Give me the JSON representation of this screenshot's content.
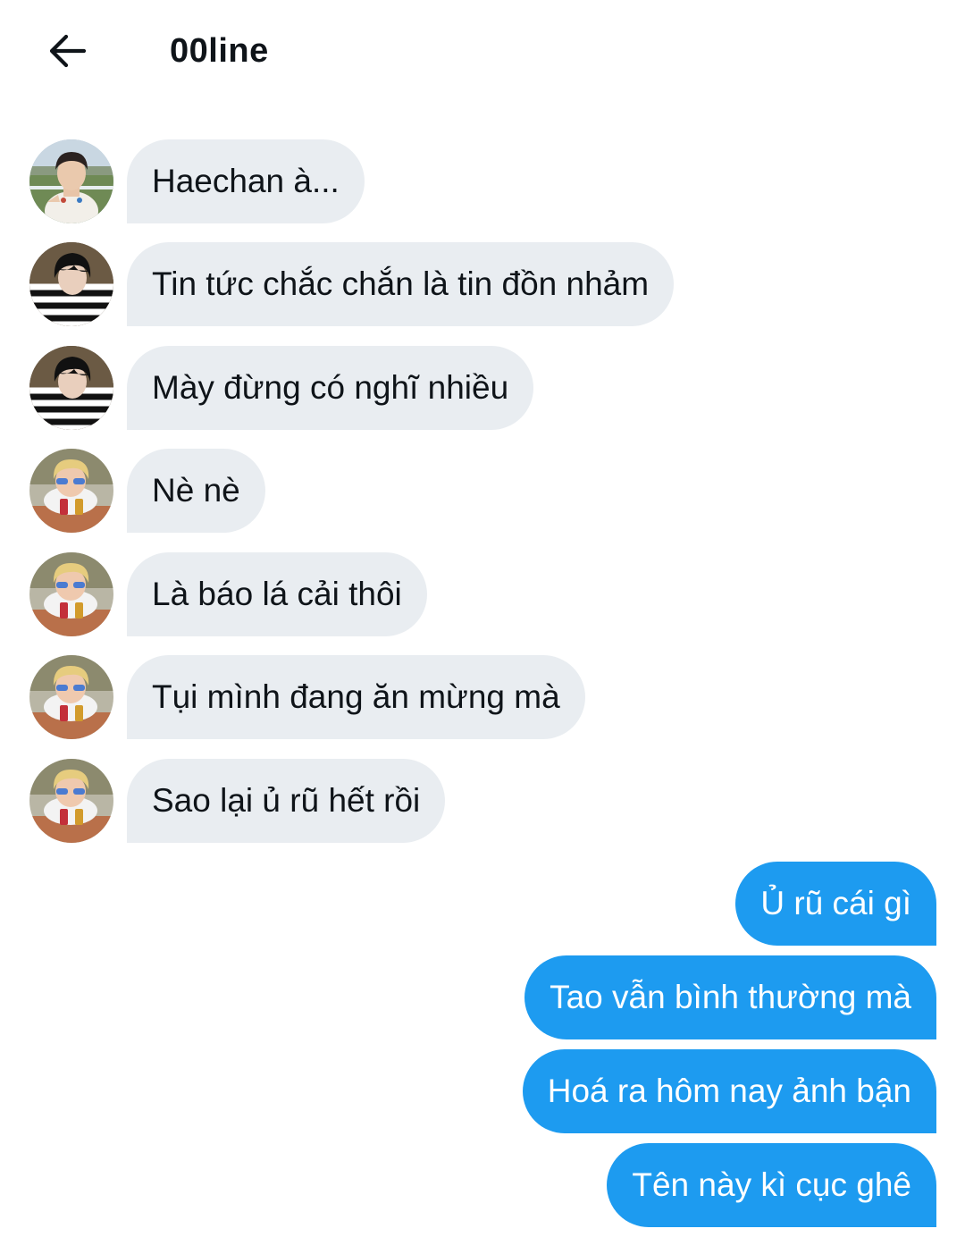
{
  "header": {
    "back_icon": "arrow-left-icon",
    "title": "00line"
  },
  "colors": {
    "incoming_bubble": "#e9edf1",
    "outgoing_bubble": "#1d9bf0",
    "text": "#0f1419"
  },
  "messages": [
    {
      "direction": "incoming",
      "avatar": "avatar-a",
      "text": "Haechan à..."
    },
    {
      "direction": "incoming",
      "avatar": "avatar-b",
      "text": "Tin tức chắc chắn là tin đồn nhảm"
    },
    {
      "direction": "incoming",
      "avatar": "avatar-b",
      "text": "Mày đừng có nghĩ nhiều"
    },
    {
      "direction": "incoming",
      "avatar": "avatar-c",
      "text": "Nè nè"
    },
    {
      "direction": "incoming",
      "avatar": "avatar-c",
      "text": "Là báo lá cải thôi"
    },
    {
      "direction": "incoming",
      "avatar": "avatar-c",
      "text": "Tụi mình đang ăn mừng mà"
    },
    {
      "direction": "incoming",
      "avatar": "avatar-c",
      "text": "Sao lại ủ rũ hết rồi"
    },
    {
      "direction": "outgoing",
      "text": "Ủ rũ cái gì"
    },
    {
      "direction": "outgoing",
      "text": "Tao vẫn bình thường mà"
    },
    {
      "direction": "outgoing",
      "text": "Hoá ra hôm nay ảnh bận"
    },
    {
      "direction": "outgoing",
      "text": "Tên này kì cục ghê"
    }
  ]
}
